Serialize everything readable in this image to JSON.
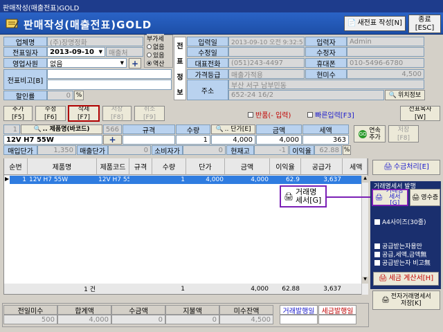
{
  "window": {
    "title": "판매작성(매출전표)GOLD"
  },
  "header": {
    "app_title": "판매작성(매출전표)GOLD",
    "new_slip_label": "새전표 작성[N]",
    "close_label": "종료",
    "close_sub": "[ESC]"
  },
  "form": {
    "company_label": "업체명",
    "company_value": "(주)장명정화",
    "date_label": "전표일자",
    "date_value": "2013-09-10",
    "sale_type": "매출처",
    "staff_label": "영업사원",
    "staff_value": "없음",
    "memo_label": "전표비고[B]",
    "discount_label": "할인률",
    "discount_value": "0",
    "vat_title": "부가세",
    "vat_options": [
      "없음",
      "있음",
      "역산"
    ],
    "vat_selected": 2
  },
  "info": {
    "side_label_chars": [
      "전",
      "표",
      "정",
      "보"
    ],
    "input_date_label": "입력일",
    "input_date_value": "2013-09-10 오전 9:32:5",
    "input_user_label": "입력자",
    "input_user_value": "Admin",
    "modify_date_label": "수정일",
    "modify_user_label": "수정자",
    "phone_label": "대표전화",
    "phone_value": "(051)243-4497",
    "mobile_label": "휴대폰",
    "mobile_value": "010-5496-6780",
    "price_grade_label": "가격등급",
    "price_grade_value": "매출가적용",
    "balance_label": "현미수",
    "balance_value": "4,500",
    "address_label": "주소",
    "address1": "부산 서구 남부민동",
    "address2": "652-24 16/2",
    "location_label": "위치정보"
  },
  "toolbar": {
    "add": "추가",
    "add_key": "[F5]",
    "modify": "수정",
    "modify_key": "[F6]",
    "delete": "삭제",
    "delete_key": "[F7]",
    "save": "저장",
    "save_key": "[F8]",
    "cancel": "취소",
    "cancel_key": "[F9]",
    "return_label": "반품(- 입력)",
    "quick_label": "빠른입력[F3]",
    "copy": "전표복사",
    "copy_key": "[W]"
  },
  "entry": {
    "seq": "1",
    "product_btn": ".. 제품명(바코드)",
    "code": "566",
    "spec_label": "규격",
    "qty_label": "수량",
    "price_btn": ".. 단가[E]",
    "amount_label": "금액",
    "tax_label": "세액",
    "product_value": "12V H7 55W",
    "qty_value": "1",
    "price_value": "4,000",
    "amount_value": "4,000",
    "tax_value": "363",
    "continuous": "연속",
    "continuous2": "추가",
    "save": "저장",
    "save_key": "[F8]",
    "buy_price_label": "매입단가",
    "buy_price_value": "1,350",
    "sale_price_label": "매출단가",
    "sale_price_value": "0",
    "consumer_price_label": "소비자가",
    "consumer_price_value": "0",
    "stock_label": "현재고",
    "stock_value": "-1",
    "margin_label": "이익율",
    "margin_value": "62.88"
  },
  "grid": {
    "columns": [
      "순번",
      "제품명",
      "제품코드",
      "규격",
      "수량",
      "단가",
      "금액",
      "이익율",
      "공급가",
      "세액"
    ],
    "rows": [
      {
        "seq": "1",
        "name": "12V H7 55W",
        "code": "12V H7 55",
        "spec": "",
        "qty": "1",
        "price": "4,000",
        "amount": "4,000",
        "margin": "62.9",
        "supply": "3,637",
        "tax": ""
      }
    ],
    "footer": {
      "count": "1 건",
      "qty": "1",
      "amount": "4,000",
      "margin": "62.88",
      "supply": "3,637"
    }
  },
  "callout": {
    "line1": "거래명",
    "line2": "세서[G]"
  },
  "side": {
    "receipt": "수금처리[E]",
    "print_section": "거래명세서 발행",
    "trade_stmt": "거래명세서[G]",
    "receipt_print": "영수증",
    "a4": "A4사이즈(30줄)",
    "opt1": "공급받는자용만",
    "opt2": "공급,세액,금액無",
    "opt3": "공급받는자 비고無",
    "tax_invoice": "세금 계산서[H]",
    "e_stmt": "전자거래명세서",
    "e_stmt2": "저장[K]"
  },
  "summary": {
    "labels": [
      "전일미수",
      "합계액",
      "수금액",
      "지불액",
      "미수잔액"
    ],
    "values": [
      "500",
      "4,000",
      "0",
      "0",
      "4,500"
    ],
    "trade_date_label": "거래발행일",
    "tax_date_label": "세금발행일"
  }
}
